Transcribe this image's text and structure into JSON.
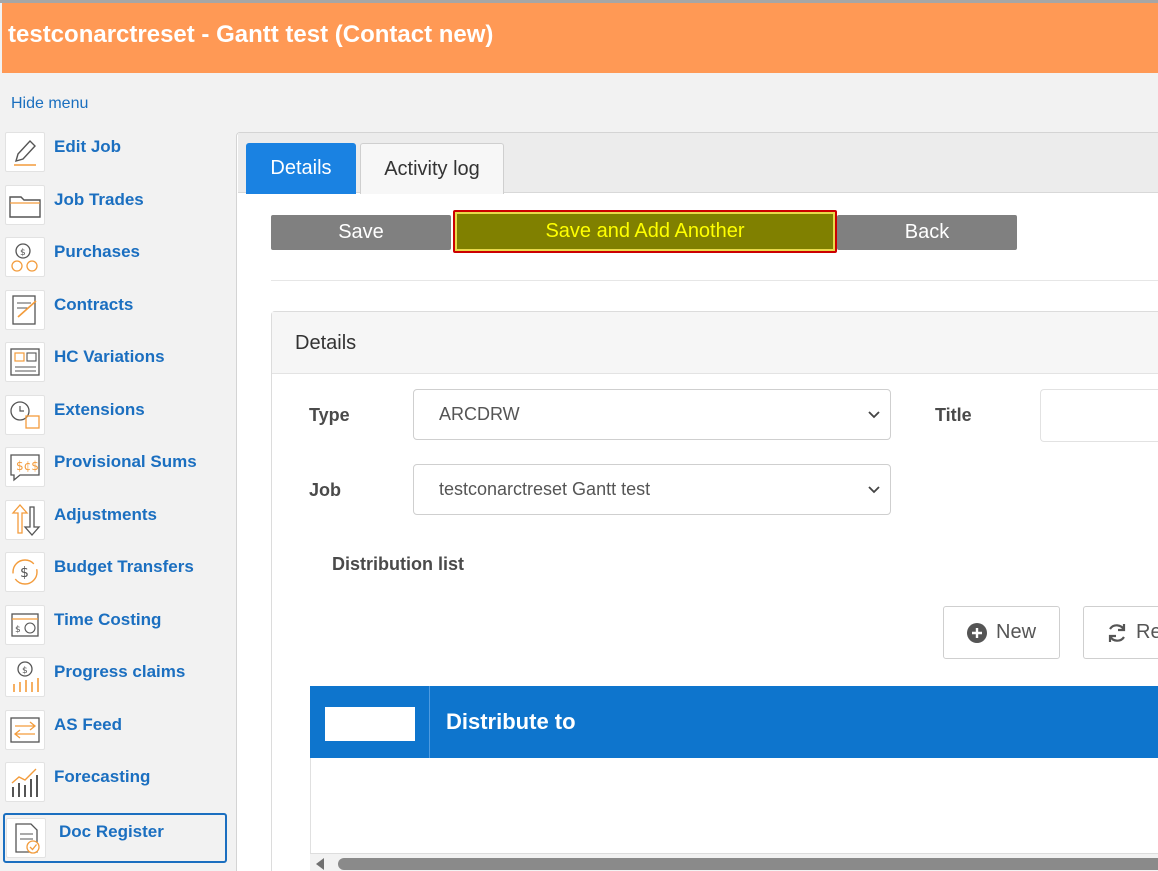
{
  "header": {
    "title": "testconarctreset - Gantt test (Contact new)"
  },
  "menu": {
    "hide_label": "Hide menu"
  },
  "sidebar": {
    "items": [
      {
        "label": "Edit Job",
        "icon": "pencil-icon"
      },
      {
        "label": "Job Trades",
        "icon": "folder-icon"
      },
      {
        "label": "Purchases",
        "icon": "coins-icon"
      },
      {
        "label": "Contracts",
        "icon": "contract-icon"
      },
      {
        "label": "HC Variations",
        "icon": "calculator-icon"
      },
      {
        "label": "Extensions",
        "icon": "clock-calendar-icon"
      },
      {
        "label": "Provisional Sums",
        "icon": "dollar-chat-icon"
      },
      {
        "label": "Adjustments",
        "icon": "up-down-arrows-icon"
      },
      {
        "label": "Budget Transfers",
        "icon": "dollar-cycle-icon"
      },
      {
        "label": "Time Costing",
        "icon": "time-money-icon"
      },
      {
        "label": "Progress claims",
        "icon": "progress-coins-icon"
      },
      {
        "label": "AS Feed",
        "icon": "transfer-doc-icon"
      },
      {
        "label": "Forecasting",
        "icon": "growth-chart-icon"
      },
      {
        "label": "Doc Register",
        "icon": "doc-check-icon"
      }
    ]
  },
  "tabs": [
    {
      "label": "Details"
    },
    {
      "label": "Activity log"
    }
  ],
  "toolbar": {
    "save_label": "Save",
    "save_add_label": "Save and Add Another",
    "back_label": "Back"
  },
  "panel": {
    "title": "Details",
    "type_label": "Type",
    "type_value": "ARCDRW",
    "title_label": "Title",
    "job_label": "Job",
    "job_value": "testconarctreset Gantt test",
    "distribution_label": "Distribution list"
  },
  "grid": {
    "new_label": "New",
    "refresh_label": "Re",
    "column_distribute": "Distribute to"
  },
  "colors": {
    "header_bg": "#ff9955",
    "link_blue": "#1b6fc0",
    "active_tab": "#1a82e2",
    "grid_head": "#0e75cd",
    "highlight_button_bg": "#808000",
    "highlight_button_text": "#ffff00"
  }
}
